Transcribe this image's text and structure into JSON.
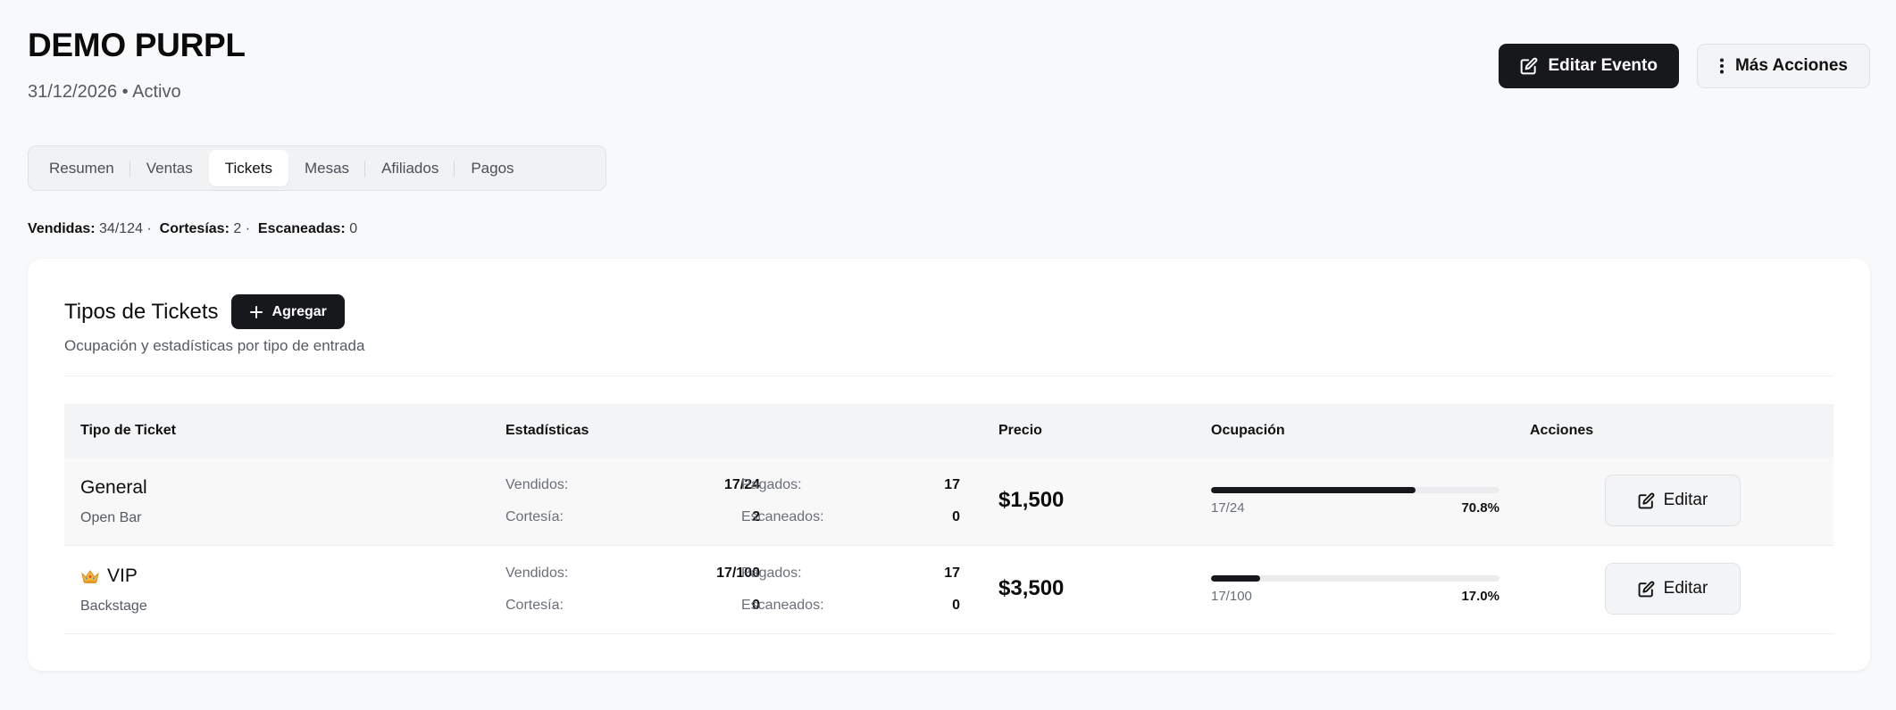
{
  "event": {
    "title": "DEMO PURPL",
    "date": "31/12/2026",
    "separator": "•",
    "status": "Activo"
  },
  "actions": {
    "edit_event": "Editar Evento",
    "more_actions": "Más Acciones"
  },
  "tabs": [
    {
      "label": "Resumen",
      "active": false
    },
    {
      "label": "Ventas",
      "active": false
    },
    {
      "label": "Tickets",
      "active": true
    },
    {
      "label": "Mesas",
      "active": false
    },
    {
      "label": "Afiliados",
      "active": false
    },
    {
      "label": "Pagos",
      "active": false
    }
  ],
  "summary": {
    "sold_label": "Vendidas:",
    "sold_value": "34/124 ·",
    "courtesy_label": "Cortesías:",
    "courtesy_value": "2 ·",
    "scanned_label": "Escaneadas:",
    "scanned_value": "0"
  },
  "card": {
    "title": "Tipos de Tickets",
    "add_label": "Agregar",
    "description": "Ocupación y estadísticas por tipo de entrada"
  },
  "table": {
    "headers": {
      "type": "Tipo de Ticket",
      "stats": "Estadísticas",
      "price": "Precio",
      "occupancy": "Ocupación",
      "actions": "Acciones"
    },
    "stat_labels": {
      "sold": "Vendidos:",
      "paid": "Pagados:",
      "courtesy": "Cortesía:",
      "scanned": "Escaneados:"
    },
    "edit_label": "Editar",
    "rows": [
      {
        "name": "General",
        "icon": "",
        "description": "Open Bar",
        "sold": "17/24",
        "paid": "17",
        "courtesy": "2",
        "scanned": "0",
        "price": "$1,500",
        "occupancy_text": "17/24",
        "occupancy_pct": "70.8%",
        "occupancy_fraction": 0.708
      },
      {
        "name": "VIP",
        "icon": "crown-icon",
        "description": "Backstage",
        "sold": "17/100",
        "paid": "17",
        "courtesy": "0",
        "scanned": "0",
        "price": "$3,500",
        "occupancy_text": "17/100",
        "occupancy_pct": "17.0%",
        "occupancy_fraction": 0.17
      }
    ]
  }
}
